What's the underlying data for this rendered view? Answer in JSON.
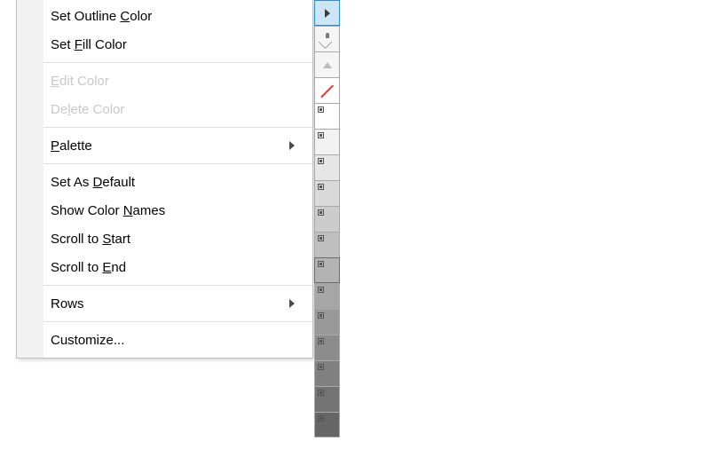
{
  "menu": {
    "set_outline_pre": "Set Outline ",
    "set_outline_u": "C",
    "set_outline_post": "olor",
    "set_fill_pre": "Set ",
    "set_fill_u": "F",
    "set_fill_post": "ill Color",
    "edit_u": "E",
    "edit_post": "dit Color",
    "delete_pre": "De",
    "delete_u": "l",
    "delete_post": "ete Color",
    "palette_u": "P",
    "palette_post": "alette",
    "default_pre": "Set As ",
    "default_u": "D",
    "default_post": "efault",
    "names_pre": "Show Color ",
    "names_u": "N",
    "names_post": "ames",
    "scroll_start_pre": "Scroll to ",
    "scroll_start_u": "S",
    "scroll_start_post": "tart",
    "scroll_end_pre": "Scroll to ",
    "scroll_end_u": "E",
    "scroll_end_post": "nd",
    "rows": "Rows",
    "customize": "Customize..."
  },
  "palette": {
    "swatches": [
      {
        "type": "none",
        "selected": false
      },
      {
        "type": "gray",
        "value": "#ffffff",
        "selected": false
      },
      {
        "type": "gray",
        "value": "#f2f2f2",
        "selected": false
      },
      {
        "type": "gray",
        "value": "#e6e6e6",
        "selected": false
      },
      {
        "type": "gray",
        "value": "#d9d9d9",
        "selected": false
      },
      {
        "type": "gray",
        "value": "#cccccc",
        "selected": false
      },
      {
        "type": "gray",
        "value": "#bfbfbf",
        "selected": false
      },
      {
        "type": "gray",
        "value": "#b3b3b3",
        "selected": true
      },
      {
        "type": "gray",
        "value": "#a6a6a6",
        "selected": false
      },
      {
        "type": "gray",
        "value": "#999999",
        "selected": false
      },
      {
        "type": "gray",
        "value": "#8c8c8c",
        "selected": false
      },
      {
        "type": "gray",
        "value": "#808080",
        "selected": false
      },
      {
        "type": "gray",
        "value": "#737373",
        "selected": false
      },
      {
        "type": "gray",
        "value": "#666666",
        "selected": false
      }
    ]
  }
}
